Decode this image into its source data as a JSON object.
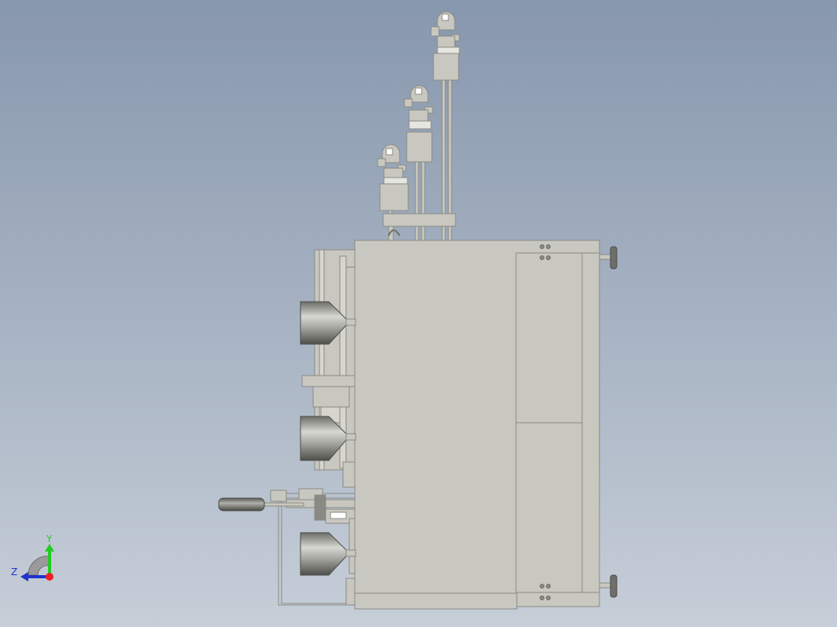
{
  "viewport": {
    "background_top": "#8797ad",
    "background_bottom": "#c6ced8",
    "model_color": "#c8c8c0",
    "model_edge": "#8a8a84",
    "dark_part": "#6e6e6a"
  },
  "triad": {
    "y_label": "Y",
    "z_label": "Z",
    "y_color": "#22cc22",
    "z_color": "#2233cc",
    "x_color": "#ee2222"
  }
}
